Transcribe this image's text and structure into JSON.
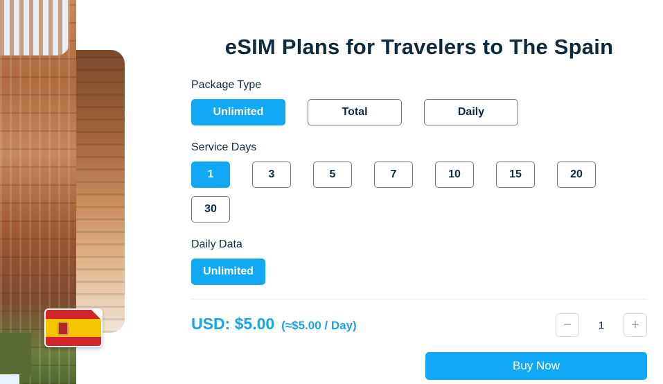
{
  "title": "eSIM Plans for Travelers to The Spain",
  "package_type": {
    "label": "Package Type",
    "options": [
      "Unlimited",
      "Total",
      "Daily"
    ],
    "selected": "Unlimited"
  },
  "service_days": {
    "label": "Service Days",
    "options": [
      "1",
      "3",
      "5",
      "7",
      "10",
      "15",
      "20",
      "30"
    ],
    "selected": "1"
  },
  "daily_data": {
    "label": "Daily Data",
    "options": [
      "Unlimited"
    ],
    "selected": "Unlimited"
  },
  "price": {
    "main": "USD: $5.00",
    "per_day": "(≈$5.00 / Day)"
  },
  "quantity": {
    "decrement": "−",
    "value": "1",
    "increment": "+"
  },
  "buy_button": "Buy Now",
  "colors": {
    "accent": "#11a8f5",
    "text": "#0e2a3d",
    "price": "#1aa3ea"
  },
  "icons": {
    "flag": "spain-flag-icon",
    "minus": "minus-icon",
    "plus": "plus-icon"
  }
}
